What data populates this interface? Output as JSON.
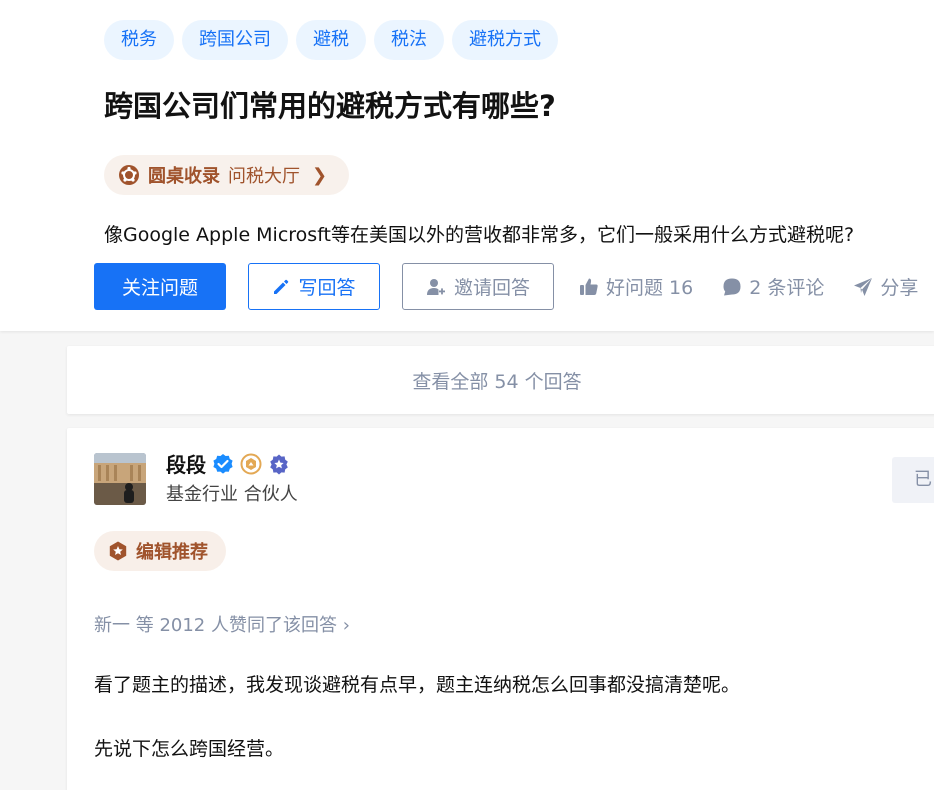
{
  "question": {
    "topics": [
      "税务",
      "跨国公司",
      "避税",
      "税法",
      "避税方式"
    ],
    "title": "跨国公司们常用的避税方式有哪些?",
    "roundtable": {
      "name": "圆桌收录",
      "sub": "问税大厅",
      "chevron": "❯"
    },
    "detail": "像Google Apple Microsft等在美国以外的营收都非常多，它们一般采用什么方式避税呢?",
    "actions": {
      "follow": "关注问题",
      "write": "写回答",
      "invite": "邀请回答",
      "good_question": "好问题 16",
      "comments": "2 条评论",
      "share": "分享"
    },
    "view_all": "查看全部 54 个回答"
  },
  "answer": {
    "author": {
      "name": "段段",
      "bio": "基金行业 合伙人",
      "follow_state": "已"
    },
    "editor_pick": "编辑推荐",
    "voters": "新一 等 2012 人赞同了该回答 ›",
    "paragraphs": [
      "看了题主的描述，我发现谈避税有点早，题主连纳税怎么回事都没搞清楚呢。",
      "先说下怎么跨国经营。"
    ]
  },
  "colors": {
    "brand_blue": "#1772f6",
    "topic_bg": "#ebf5ff",
    "muted": "#8590a6",
    "roundtable_brown": "#a0532c",
    "roundtable_bg": "#f8f1ec"
  }
}
